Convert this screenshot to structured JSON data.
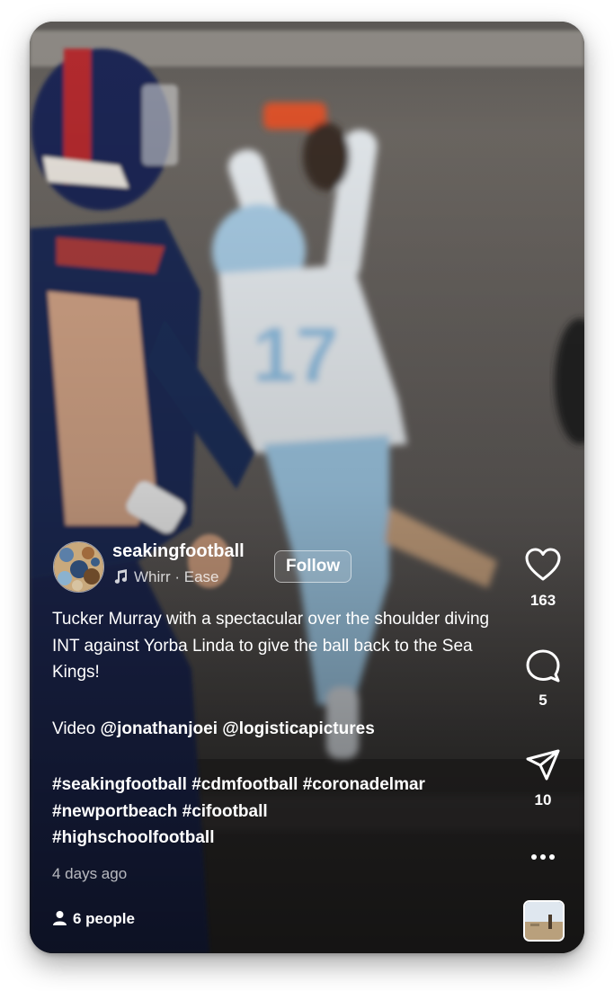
{
  "post": {
    "username": "seakingfootball",
    "audio": {
      "artist": "Whirr",
      "separator": "·",
      "track": "Ease"
    },
    "follow_label": "Follow",
    "caption": {
      "line1": "Tucker Murray with a spectacular over the shoulder diving INT against Yorba Linda to give the ball back to the Sea Kings!",
      "credit_prefix": "Video",
      "credits": [
        "@jonathanjoei",
        "@logisticapictures"
      ],
      "hashtags_line1": "#seakingfootball #cdmfootball #coronadelmar",
      "hashtags_line2": "#newportbeach #cifootball",
      "hashtags_line3": "#highschoolfootball"
    },
    "timestamp": "4 days ago",
    "people_label": "6 people"
  },
  "actions": {
    "likes": "163",
    "comments": "5",
    "shares": "10"
  },
  "icons": {
    "like": "heart-icon",
    "comment": "comment-bubble-icon",
    "share": "paper-plane-icon",
    "more": "more-dots-icon",
    "music": "music-note-icon",
    "people": "person-icon"
  },
  "colors": {
    "overlay_text": "#ffffff",
    "jersey_light_blue": "#9cc6e3",
    "jersey_navy": "#1b2a52",
    "glove_orange": "#e0522a"
  }
}
